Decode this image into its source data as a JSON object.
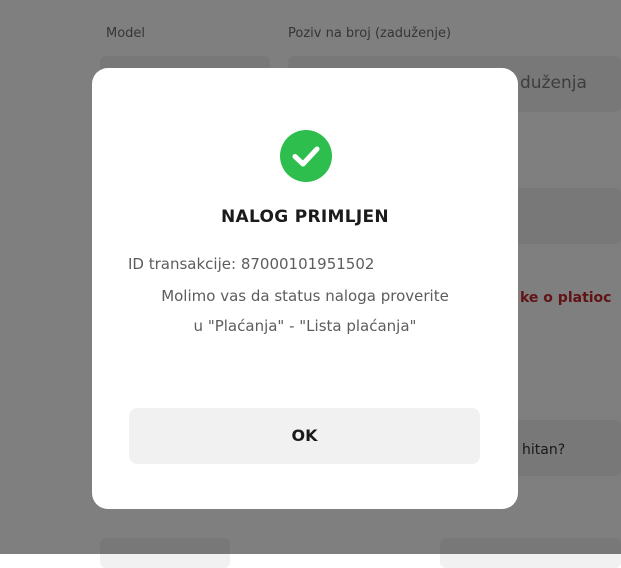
{
  "background": {
    "model_label": "Model",
    "reference_label": "Poziv na broj (zaduženje)",
    "reference_placeholder_tail": "duženja",
    "warning_text_tail": "ke o platioc",
    "urgent_text_tail": "hitan?"
  },
  "dialog": {
    "icon": "check-circle-icon",
    "icon_color": "#2dbe4e",
    "title": "NALOG PRIMLJEN",
    "transaction_line": "ID transakcije: 87000101951502",
    "message_line_1": "Molimo vas da status naloga proverite",
    "message_line_2": "u \"Plaćanja\" - \"Lista plaćanja\"",
    "ok_label": "OK"
  }
}
